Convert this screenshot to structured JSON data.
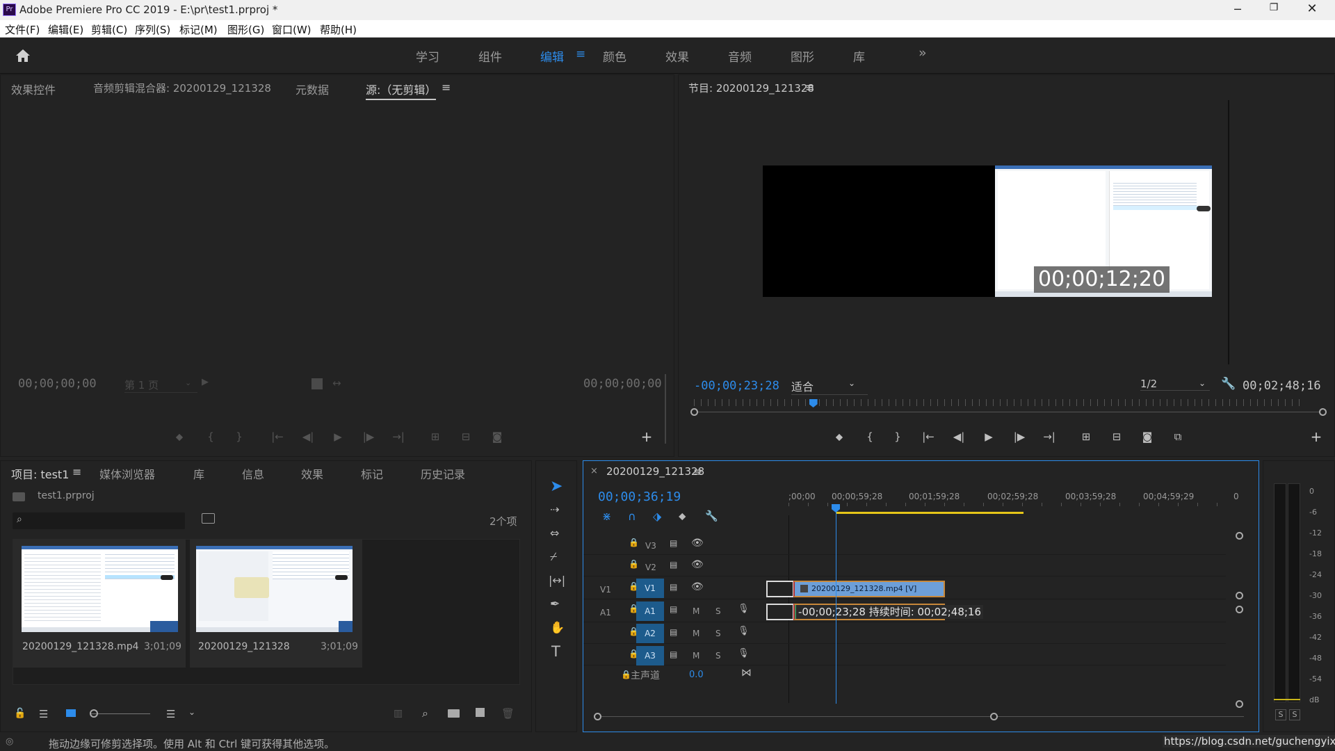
{
  "app": {
    "title": "Adobe Premiere Pro CC 2019 - E:\\pr\\test1.prproj *",
    "logo": "Pr"
  },
  "menu": [
    "文件(F)",
    "编辑(E)",
    "剪辑(C)",
    "序列(S)",
    "标记(M)",
    "图形(G)",
    "窗口(W)",
    "帮助(H)"
  ],
  "workspaces": [
    "学习",
    "组件",
    "编辑",
    "颜色",
    "效果",
    "音频",
    "图形",
    "库"
  ],
  "workspace_active": "编辑",
  "source_panel": {
    "tabs": [
      "效果控件",
      "音频剪辑混合器: 20200129_121328",
      "元数据",
      "源:（无剪辑）"
    ],
    "tc_left": "00;00;00;00",
    "page": "第 1 页",
    "tc_right": "00;00;00;00"
  },
  "program_panel": {
    "title": "节目: 20200129_121328",
    "overlay_tc": "00;00;12;20",
    "current_tc": "-00;00;23;28",
    "fit": "适合",
    "resolution": "1/2",
    "duration": "00;02;48;16",
    "playhead_fraction": 0.195
  },
  "project_panel": {
    "tabs": [
      "项目: test1",
      "媒体浏览器",
      "库",
      "信息",
      "效果",
      "标记",
      "历史记录"
    ],
    "file": "test1.prproj",
    "count": "2个项",
    "items": [
      {
        "name": "20200129_121328.mp4",
        "duration": "3;01;09"
      },
      {
        "name": "20200129_121328",
        "duration": "3;01;09"
      }
    ]
  },
  "timeline": {
    "title": "20200129_121328",
    "timecode": "00;00;36;19",
    "ruler": [
      ";00;00",
      "00;00;59;28",
      "00;01;59;28",
      "00;02;59;28",
      "00;03;59;28",
      "00;04;59;29",
      "0"
    ],
    "video_tracks": [
      "V3",
      "V2",
      "V1"
    ],
    "audio_tracks": [
      "A1",
      "A2",
      "A3"
    ],
    "src_v": "V1",
    "src_a": "A1",
    "clip_label": "20200129_121328.mp4 [V]",
    "drag_tooltip": "-00;00;23;28 持续时间: 00;02;48;16",
    "master_label": "主声道",
    "master_value": "0.0",
    "m_label": "M",
    "s_label": "S"
  },
  "meter": {
    "scale": [
      "0",
      "-6",
      "-12",
      "-18",
      "-24",
      "-30",
      "-36",
      "-42",
      "-48",
      "-54",
      "dB"
    ],
    "solo": [
      "S",
      "S"
    ]
  },
  "status": {
    "hint": "拖动边缘可修剪选择项。使用 Alt 和 Ctrl 键可获得其他选项。",
    "watermark": "https://blog.csdn.net/guchengyixin"
  },
  "colors": {
    "accent": "#2d8ceb",
    "clip_video": "#6d9fd8",
    "clip_audio": "#3f8f5c",
    "work_area": "#e6c619",
    "panel_bg": "#232323"
  }
}
